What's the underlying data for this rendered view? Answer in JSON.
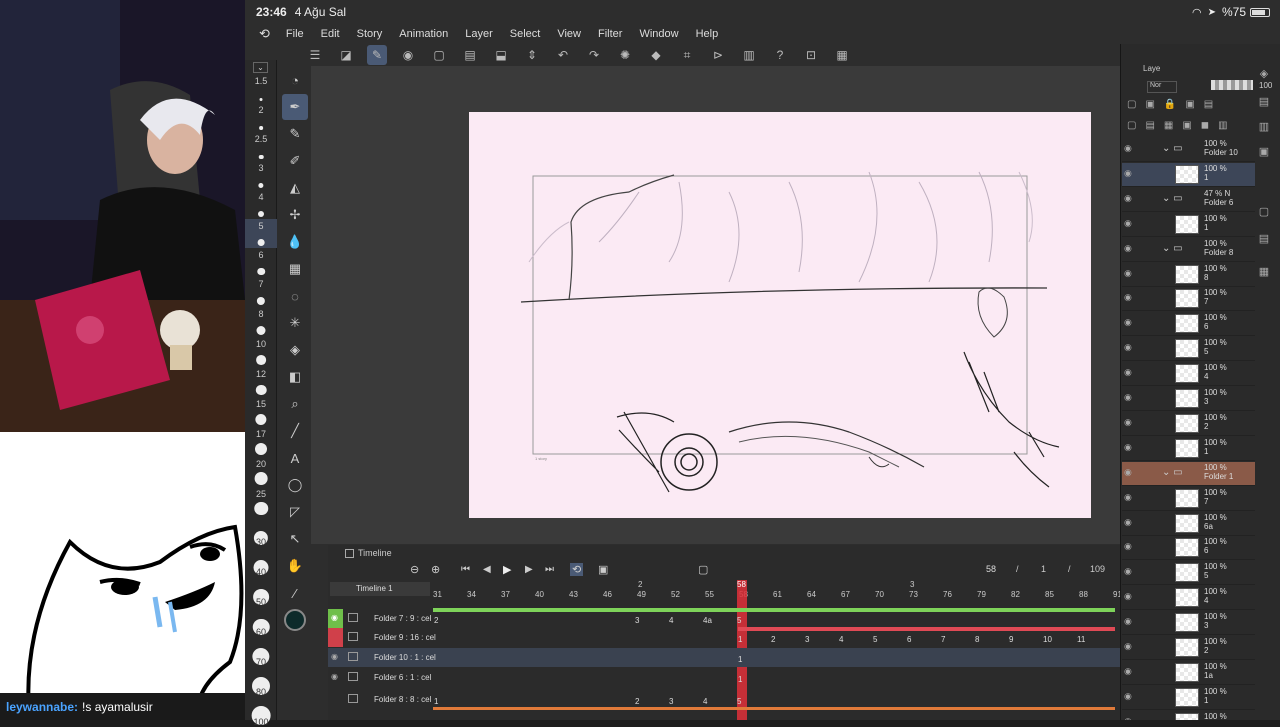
{
  "status": {
    "time": "23:46",
    "date": "4 Ağu Sal",
    "battery": "%75"
  },
  "menu": [
    "File",
    "Edit",
    "Story",
    "Animation",
    "Layer",
    "Select",
    "View",
    "Filter",
    "Window",
    "Help"
  ],
  "brush_sizes": [
    "1.5",
    "2",
    "2.5",
    "3",
    "4",
    "5",
    "6",
    "7",
    "8",
    "10",
    "12",
    "15",
    "17",
    "20",
    "25",
    "30",
    "40",
    "50",
    "60",
    "70",
    "80",
    "100"
  ],
  "selected_brush_size": "5",
  "timeline": {
    "title": "Timeline",
    "name": "Timeline 1",
    "current_frame": "58",
    "sep1": "/",
    "page": "1",
    "sep2": "/",
    "total_frames": "109",
    "ruler": [
      "31",
      "34",
      "37",
      "40",
      "43",
      "46",
      "49",
      "52",
      "55",
      "58",
      "61",
      "64",
      "67",
      "70",
      "73",
      "76",
      "79",
      "82",
      "85",
      "88",
      "91"
    ],
    "ruler_top": [
      "2",
      "3"
    ],
    "layers": [
      {
        "name": "Folder 7 : 9 : cel",
        "cells": [
          "3",
          "4",
          "4a",
          "5"
        ]
      },
      {
        "name": "Folder 9 : 16 : cel",
        "cells": [
          "1",
          "2",
          "3",
          "4",
          "5",
          "6",
          "7",
          "8",
          "9",
          "10",
          "11"
        ]
      },
      {
        "name": "Folder 10 : 1 : cel",
        "cells": [
          "1"
        ]
      },
      {
        "name": "Folder 6 : 1 : cel",
        "cells": [
          "1"
        ]
      },
      {
        "name": "Folder 8 : 8 : cel",
        "cells": [
          "1",
          "2",
          "3",
          "4",
          "5"
        ]
      }
    ],
    "row1_first": "2"
  },
  "layers_panel": {
    "tab": "Laye",
    "opacity": "100",
    "blend": "Nor",
    "rows": [
      {
        "pct": "100 %",
        "name": "Folder 10",
        "folder": true
      },
      {
        "pct": "100 %",
        "name": "1",
        "folder": false
      },
      {
        "pct": "47 % N",
        "name": "Folder 6",
        "folder": true
      },
      {
        "pct": "100 %",
        "name": "1",
        "folder": false
      },
      {
        "pct": "100 %",
        "name": "Folder 8",
        "folder": true
      },
      {
        "pct": "100 %",
        "name": "8",
        "folder": false
      },
      {
        "pct": "100 %",
        "name": "7",
        "folder": false
      },
      {
        "pct": "100 %",
        "name": "6",
        "folder": false
      },
      {
        "pct": "100 %",
        "name": "5",
        "folder": false
      },
      {
        "pct": "100 %",
        "name": "4",
        "folder": false
      },
      {
        "pct": "100 %",
        "name": "3",
        "folder": false
      },
      {
        "pct": "100 %",
        "name": "2",
        "folder": false
      },
      {
        "pct": "100 %",
        "name": "1",
        "folder": false
      },
      {
        "pct": "100 %",
        "name": "Folder 1",
        "folder": true
      },
      {
        "pct": "100 %",
        "name": "7",
        "folder": false
      },
      {
        "pct": "100 %",
        "name": "6a",
        "folder": false
      },
      {
        "pct": "100 %",
        "name": "6",
        "folder": false
      },
      {
        "pct": "100 %",
        "name": "5",
        "folder": false
      },
      {
        "pct": "100 %",
        "name": "4",
        "folder": false
      },
      {
        "pct": "100 %",
        "name": "3",
        "folder": false
      },
      {
        "pct": "100 %",
        "name": "2",
        "folder": false
      },
      {
        "pct": "100 %",
        "name": "1a",
        "folder": false
      },
      {
        "pct": "100 %",
        "name": "1",
        "folder": false
      },
      {
        "pct": "100 %",
        "name": "",
        "folder": false
      }
    ]
  },
  "canvas": {
    "frame_label": "1 story"
  },
  "chat": {
    "user": "leywannabe:",
    "message": "!s ayamalusir"
  },
  "colors": {
    "canvas": "#fbeaf4",
    "accent": "#4a5a75",
    "playhead": "#e0303a"
  }
}
